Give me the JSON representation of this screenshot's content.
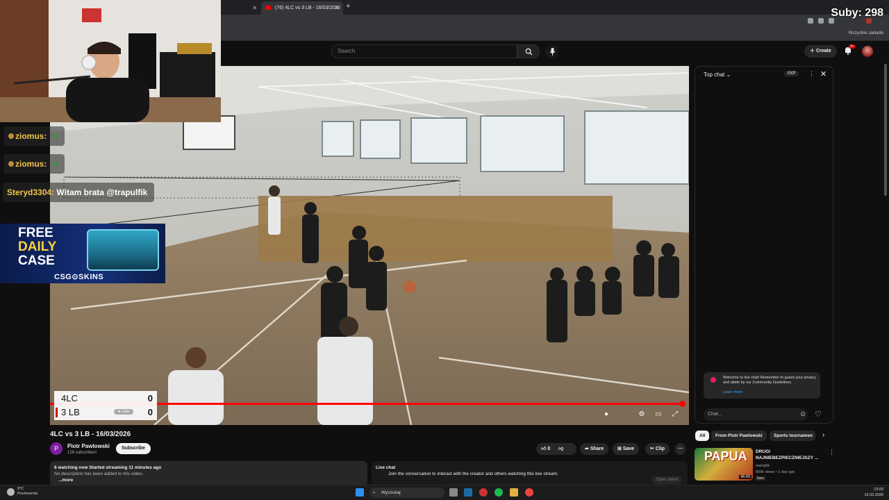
{
  "browser": {
    "tabs": [
      {
        "label": "",
        "active": false
      },
      {
        "label": "(76) 4LC vs 3 LB - 16/03/2026",
        "active": true
      }
    ],
    "bookmarks_all": "Wszystkie zakładki"
  },
  "youtube_header": {
    "search_placeholder": "Search",
    "create_label": "Create",
    "notifications_badge": "9+"
  },
  "overlay": {
    "subs_counter": "Suby: 298",
    "chat_messages": [
      {
        "name": "ziomus:",
        "text": ""
      },
      {
        "name": "ziomus:",
        "text": ""
      },
      {
        "name": "Steryd3304:",
        "text": "Witam brata @trapulfik"
      }
    ],
    "promo": {
      "line1": "FREE",
      "line2": "DAILY",
      "line3": "CASE",
      "brand": "CSG⊙SKINS"
    }
  },
  "player": {
    "scoreboard": [
      {
        "team": "4LC",
        "score": "0"
      },
      {
        "team": "3 LB",
        "score": "0"
      }
    ],
    "live_label": "Live",
    "progress_fraction": 0.995
  },
  "chat_panel": {
    "title": "Top chat",
    "xp_badge": "0XP",
    "welcome_text": "Welcome to live chat! Remember to guard your privacy and abide by our Community Guidelines.",
    "learn_more": "Learn more",
    "input_placeholder": "Chat..."
  },
  "video_info": {
    "title": "4LC vs 3 LB - 16/03/2026",
    "channel_initial": "P",
    "channel_name": "Piotr Pawlowski",
    "subscribers": "128 subscribers",
    "subscribe_label": "Subscribe",
    "like_count": "0",
    "share_label": "Share",
    "save_label": "Save",
    "clip_label": "Clip",
    "description_meta": "6 watching now  Started streaming 11 minutes ago",
    "description_text": "No description has been added to this video.",
    "more_label": "...more",
    "live_chat_heading": "Live chat",
    "live_chat_text": "Join the conversation to interact with the creator and others watching this live stream.",
    "open_panel": "Open panel"
  },
  "recommendations": {
    "chips": [
      "All",
      "From Piotr Pawlowski",
      "Sports tournamen"
    ],
    "items": [
      {
        "thumb_text": "PAPUA",
        "duration": "46:09",
        "title": "DRUGI NAJNIEBEZPIECZNIEJSZY ...",
        "channel": "owerjbik",
        "meta": "569k views • 1 day ago",
        "badge": "New"
      }
    ]
  },
  "taskbar": {
    "weather_temp": "9°C",
    "weather_desc": "Pochmurnie",
    "search_label": "Wyszukaj",
    "time": "13:00",
    "date": "16.03.2026"
  },
  "colors": {
    "accent": "#ff0000",
    "chat_name": "#f3c34d",
    "link": "#3ea6ff"
  }
}
